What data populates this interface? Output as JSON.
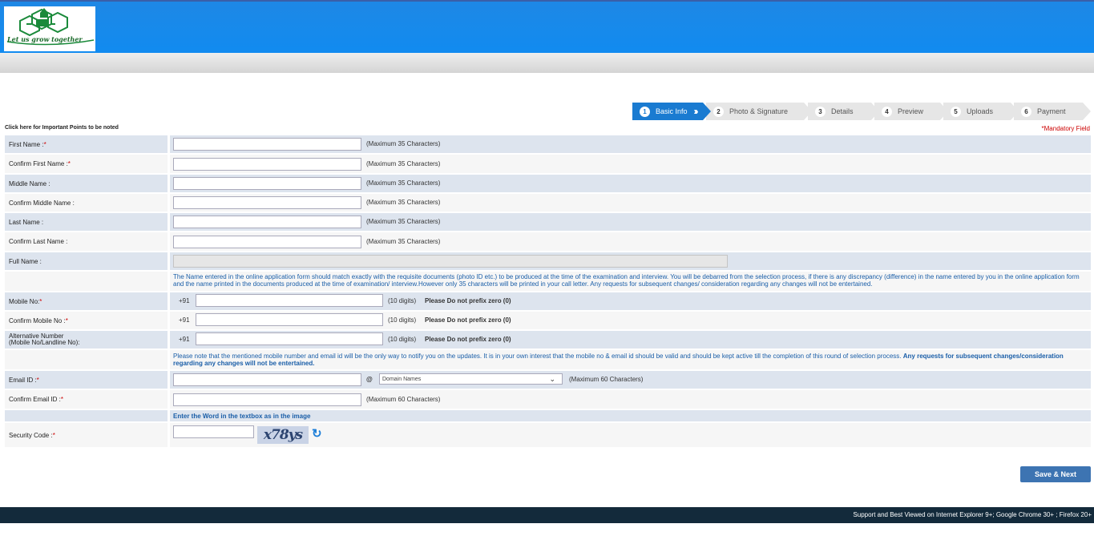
{
  "header": {
    "logo_tagline": "Let us grow together"
  },
  "steps": [
    {
      "num": "1",
      "label": "Basic Info",
      "active": true
    },
    {
      "num": "2",
      "label": "Photo & Signature",
      "active": false
    },
    {
      "num": "3",
      "label": "Details",
      "active": false
    },
    {
      "num": "4",
      "label": "Preview",
      "active": false
    },
    {
      "num": "5",
      "label": "Uploads",
      "active": false
    },
    {
      "num": "6",
      "label": "Payment",
      "active": false
    }
  ],
  "notes": {
    "important_link": "Click here for Important Points to be noted",
    "mandatory": "*Mandatory Field"
  },
  "fields": {
    "first_name": {
      "label": "First Name :",
      "req": " *",
      "hint": "(Maximum 35 Characters)",
      "value": ""
    },
    "confirm_first_name": {
      "label": "Confirm First Name :",
      "req": " *",
      "hint": "(Maximum 35 Characters)",
      "value": ""
    },
    "middle_name": {
      "label": "Middle Name :",
      "hint": "(Maximum 35 Characters)",
      "value": ""
    },
    "confirm_middle_name": {
      "label": "Confirm Middle Name :",
      "hint": "(Maximum 35 Characters)",
      "value": ""
    },
    "last_name": {
      "label": "Last Name :",
      "hint": "(Maximum 35 Characters)",
      "value": ""
    },
    "confirm_last_name": {
      "label": "Confirm Last Name :",
      "hint": "(Maximum 35 Characters)",
      "value": ""
    },
    "full_name": {
      "label": "Full Name :",
      "value": ""
    },
    "name_note": "The Name entered in the online application form should match exactly with the requisite documents (photo ID etc.) to be produced at the time of the examination and interview. You will be debarred from the selection process, if there is any discrepancy (difference) in the name entered by you in the online application form and the name printed in the documents produced at the time of examination/ interview.However only 35 characters will be printed in your call letter. Any requests for subsequent changes/ consideration regarding any changes will not be entertained.",
    "mobile": {
      "label": "Mobile No:",
      "req": "*",
      "prefix": "+91",
      "hint": "(10 digits)",
      "note": "Please Do not prefix zero (0)",
      "value": ""
    },
    "confirm_mobile": {
      "label": "Confirm Mobile No :",
      "req": "*",
      "prefix": "+91",
      "hint": "(10 digits)",
      "note": "Please Do not prefix zero (0)",
      "value": ""
    },
    "alt_number": {
      "label_line1": "Alternative Number",
      "label_line2": "(Mobile No/Landline No):",
      "prefix": "+91",
      "hint": "(10 digits)",
      "note": "Please Do not prefix zero (0)",
      "value": ""
    },
    "contact_note": "Please note that the mentioned mobile number and email id will be the only way to notify you on the updates. It is in your own interest that the mobile no & email id should be valid and should be kept active till the completion of this round of selection process.",
    "contact_note_bold": "Any requests for subsequent changes/consideration regarding any changes will not be entertained.",
    "email": {
      "label": "Email ID :",
      "req": "*",
      "at": "@",
      "domain_selected": "Domain Names",
      "hint": "(Maximum 60 Characters)",
      "value": ""
    },
    "confirm_email": {
      "label": "Confirm Email ID :",
      "req": " *",
      "hint": "(Maximum 60 Characters)",
      "value": ""
    },
    "captcha_instruction": "Enter the Word in the textbox as in the image",
    "security_code": {
      "label": "Security Code :",
      "req": "*",
      "captcha_text": "x78ys",
      "value": ""
    }
  },
  "actions": {
    "save_next": "Save & Next"
  },
  "footer": {
    "text": "Support and Best Viewed on Internet Explorer 9+; Google Chrome 30+ ; Firefox 20+"
  }
}
